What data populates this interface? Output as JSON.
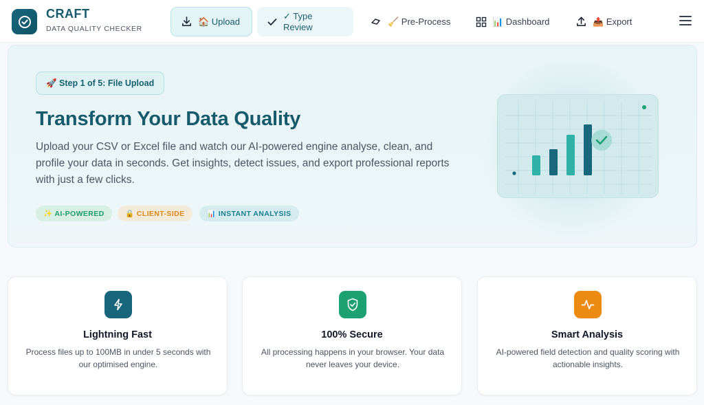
{
  "brand": {
    "name": "CRAFT",
    "subtitle": "DATA QUALITY CHECKER"
  },
  "nav": [
    {
      "label": "🏠 Upload",
      "icon": "download-icon"
    },
    {
      "label": "✓ Type Review",
      "icon": "check-icon"
    },
    {
      "label": "🧹 Pre-Process",
      "icon": "eraser-icon"
    },
    {
      "label": "📊 Dashboard",
      "icon": "grid-icon"
    },
    {
      "label": "📤 Export",
      "icon": "upload-icon"
    }
  ],
  "hero": {
    "step": "🚀 Step 1 of 5: File Upload",
    "title": "Transform Your Data Quality",
    "description": "Upload your CSV or Excel file and watch our AI-powered engine analyse, clean, and profile your data in seconds. Get insights, detect issues, and export professional reports with just a few clicks.",
    "tags": [
      "✨ AI-POWERED",
      "🔒 CLIENT-SIDE",
      "📊 INSTANT ANALYSIS"
    ]
  },
  "features": [
    {
      "title": "Lightning Fast",
      "description": "Process files up to 100MB in under 5 seconds with our optimised engine.",
      "icon": "lightning-icon",
      "color": "#17657a"
    },
    {
      "title": "100% Secure",
      "description": "All processing happens in your browser. Your data never leaves your device.",
      "icon": "shield-check-icon",
      "color": "#1da173"
    },
    {
      "title": "Smart Analysis",
      "description": "AI-powered field detection and quality scoring with actionable insights.",
      "icon": "pulse-icon",
      "color": "#ec8a12"
    }
  ],
  "colors": {
    "primary": "#175a6c",
    "accent_teal": "#2fb1a8",
    "accent_green": "#1da173",
    "accent_orange": "#ec8a12"
  }
}
